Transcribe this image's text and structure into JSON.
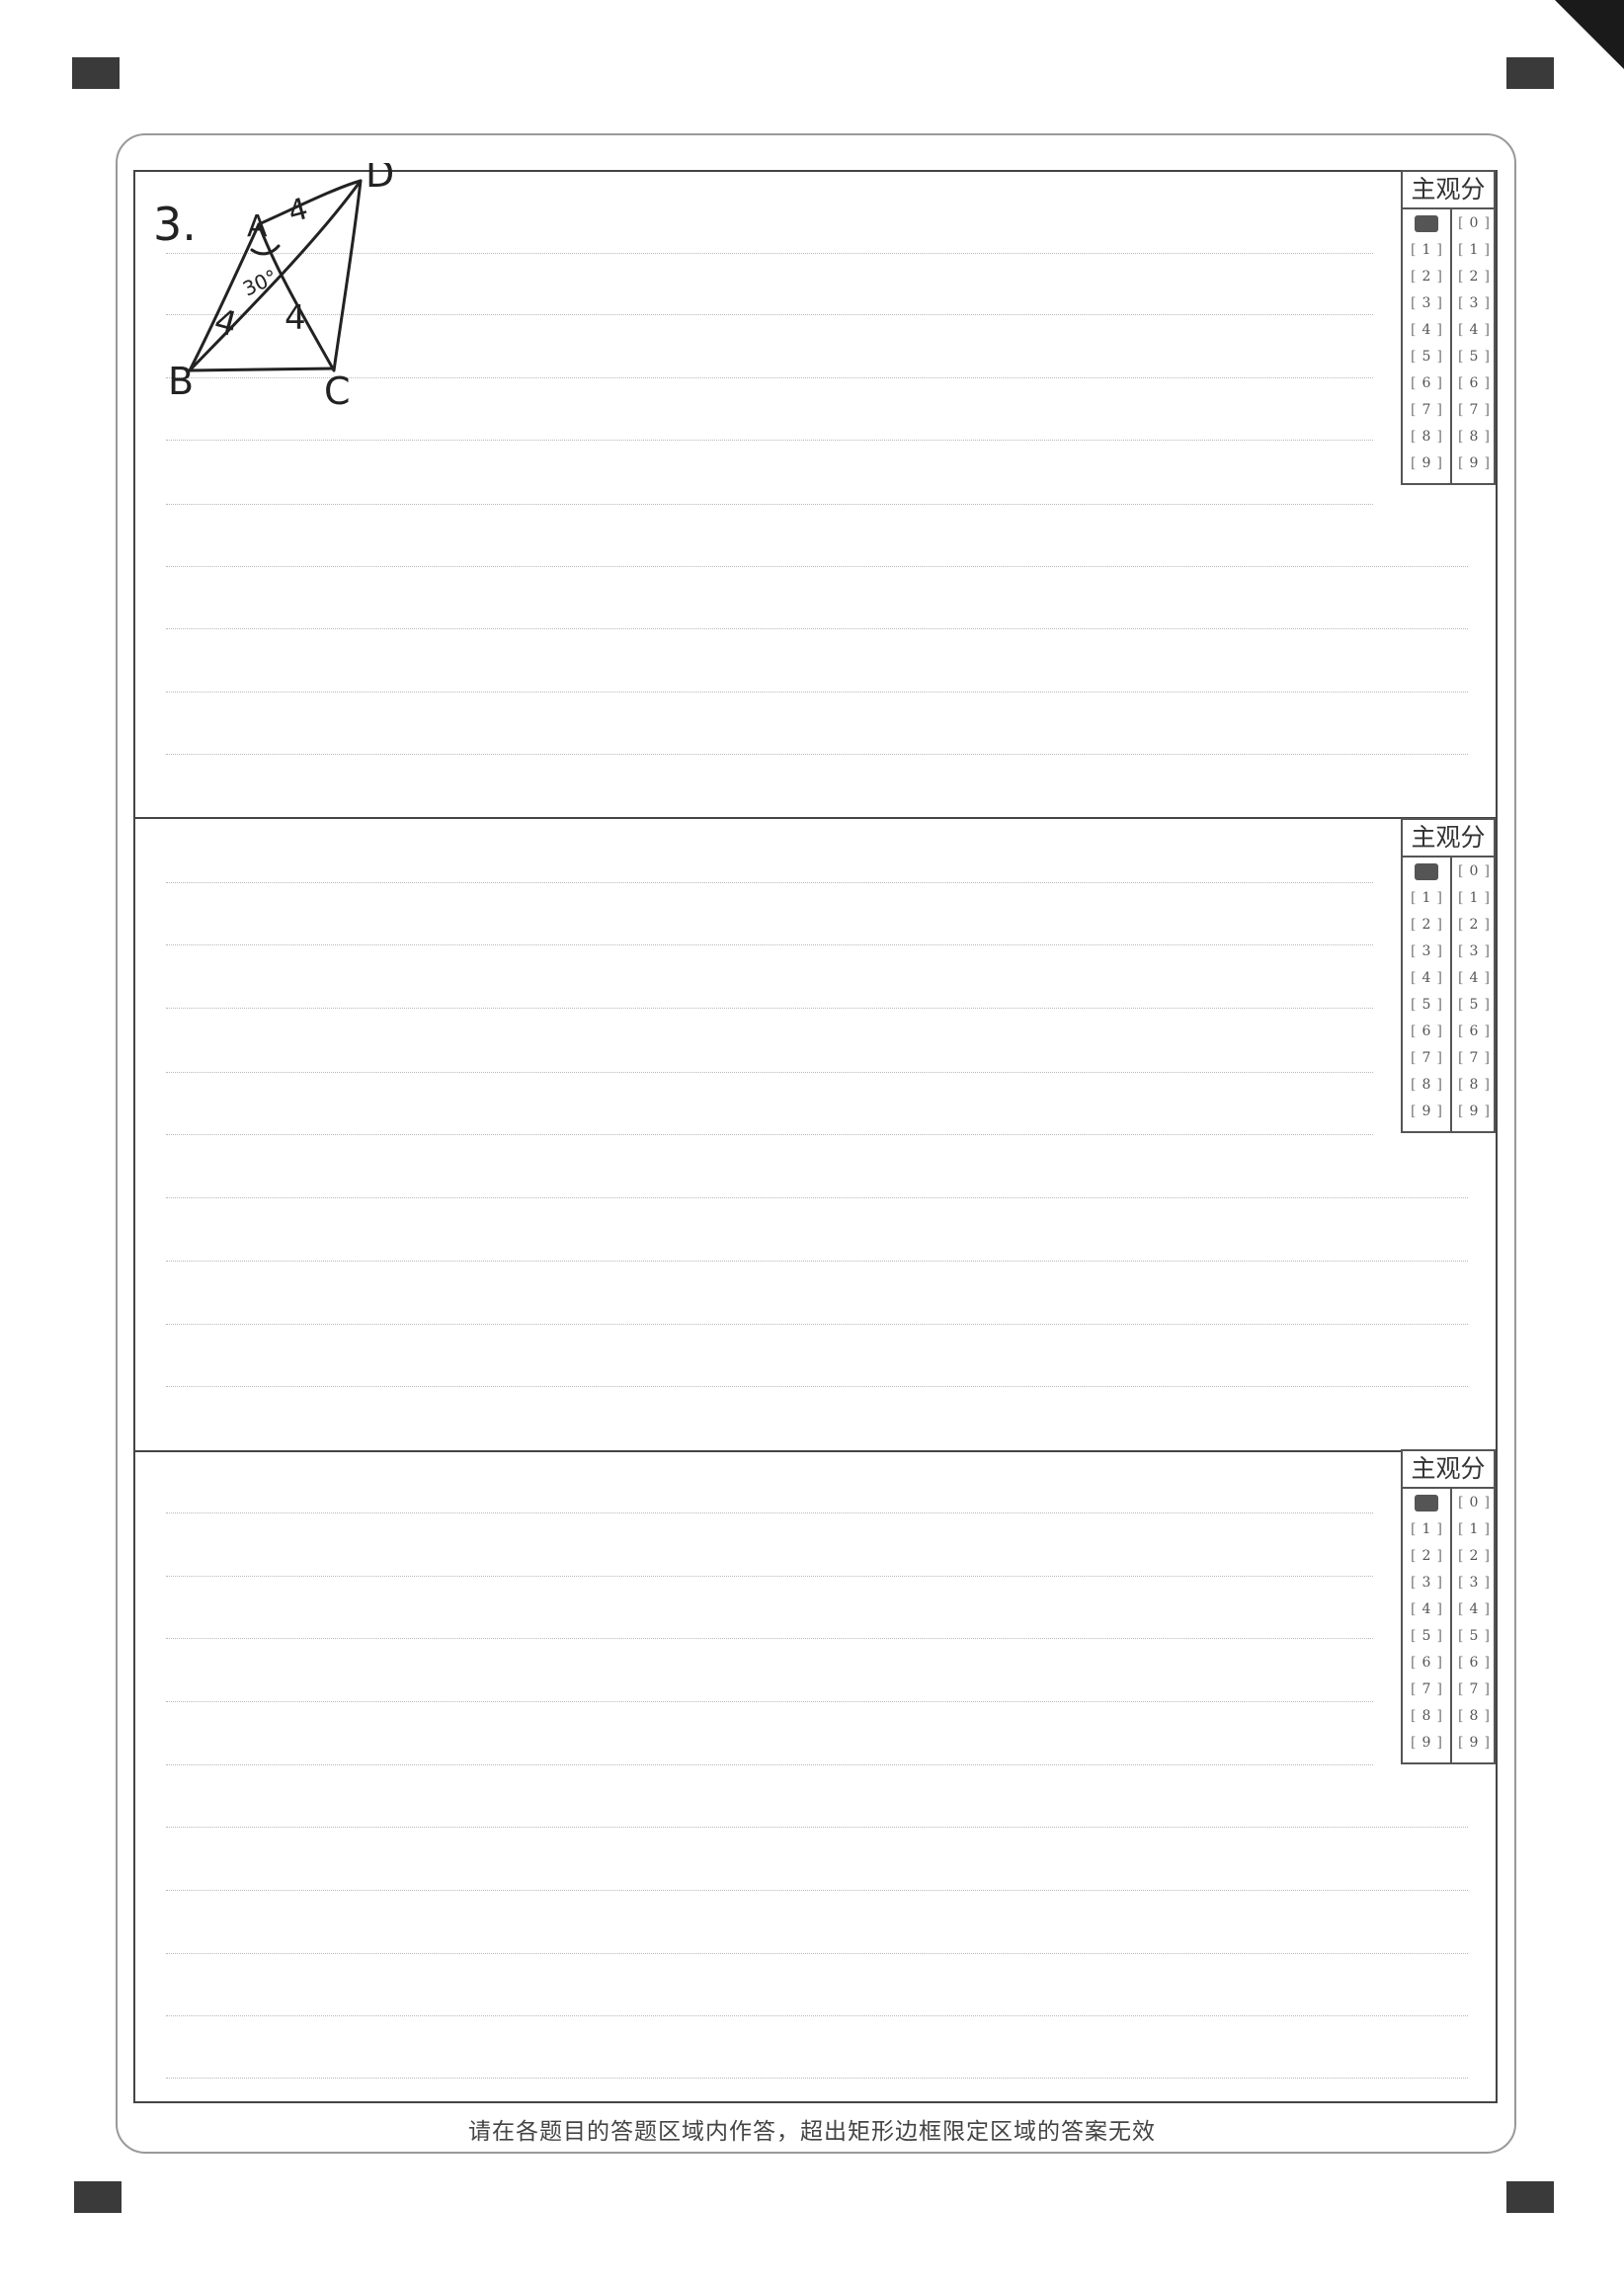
{
  "question": {
    "number": "3.",
    "diagram": {
      "labels": [
        "D",
        "A",
        "B",
        "C"
      ],
      "marks": [
        "4",
        "4",
        "4",
        "30°"
      ]
    }
  },
  "score_tables": [
    {
      "title": "主观分",
      "left_digits": [
        "",
        "1",
        "2",
        "3",
        "4",
        "5",
        "6",
        "7",
        "8",
        "9"
      ],
      "right_digits": [
        "0",
        "1",
        "2",
        "3",
        "4",
        "5",
        "6",
        "7",
        "8",
        "9"
      ],
      "filled": "left-0"
    },
    {
      "title": "主观分",
      "left_digits": [
        "",
        "1",
        "2",
        "3",
        "4",
        "5",
        "6",
        "7",
        "8",
        "9"
      ],
      "right_digits": [
        "0",
        "1",
        "2",
        "3",
        "4",
        "5",
        "6",
        "7",
        "8",
        "9"
      ],
      "filled": "left-0"
    },
    {
      "title": "主观分",
      "left_digits": [
        "",
        "1",
        "2",
        "3",
        "4",
        "5",
        "6",
        "7",
        "8",
        "9"
      ],
      "right_digits": [
        "0",
        "1",
        "2",
        "3",
        "4",
        "5",
        "6",
        "7",
        "8",
        "9"
      ],
      "filled": "left-0"
    }
  ],
  "footer": "请在各题目的答题区域内作答，超出矩形边框限定区域的答案无效"
}
